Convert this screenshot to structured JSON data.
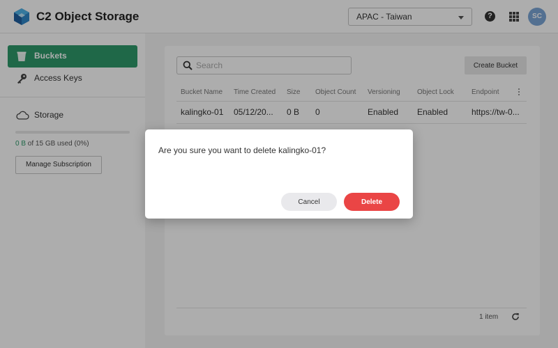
{
  "header": {
    "app_title": "C2 Object Storage",
    "region": "APAC - Taiwan",
    "help_icon": "?",
    "avatar_initials": "SC"
  },
  "sidebar": {
    "items": [
      {
        "label": "Buckets",
        "icon": "bucket-icon",
        "active": true
      },
      {
        "label": "Access Keys",
        "icon": "key-icon",
        "active": false
      }
    ],
    "storage": {
      "label": "Storage",
      "used": "0 B",
      "usage_rest": " of 15 GB used (0%)",
      "manage_label": "Manage Subscription"
    }
  },
  "main": {
    "search_placeholder": "Search",
    "create_label": "Create Bucket",
    "columns": [
      "Bucket Name",
      "Time Created",
      "Size",
      "Object Count",
      "Versioning",
      "Object Lock",
      "Endpoint"
    ],
    "rows": [
      [
        "kalingko-01",
        "05/12/20...",
        "0 B",
        "0",
        "Enabled",
        "Enabled",
        "https://tw-0..."
      ]
    ],
    "item_count": "1 item"
  },
  "dialog": {
    "message": "Are you sure you want to delete kalingko-01?",
    "cancel_label": "Cancel",
    "delete_label": "Delete"
  },
  "colors": {
    "accent": "#2e9a6a",
    "danger": "#ea4545",
    "avatar": "#7ba5d6"
  }
}
